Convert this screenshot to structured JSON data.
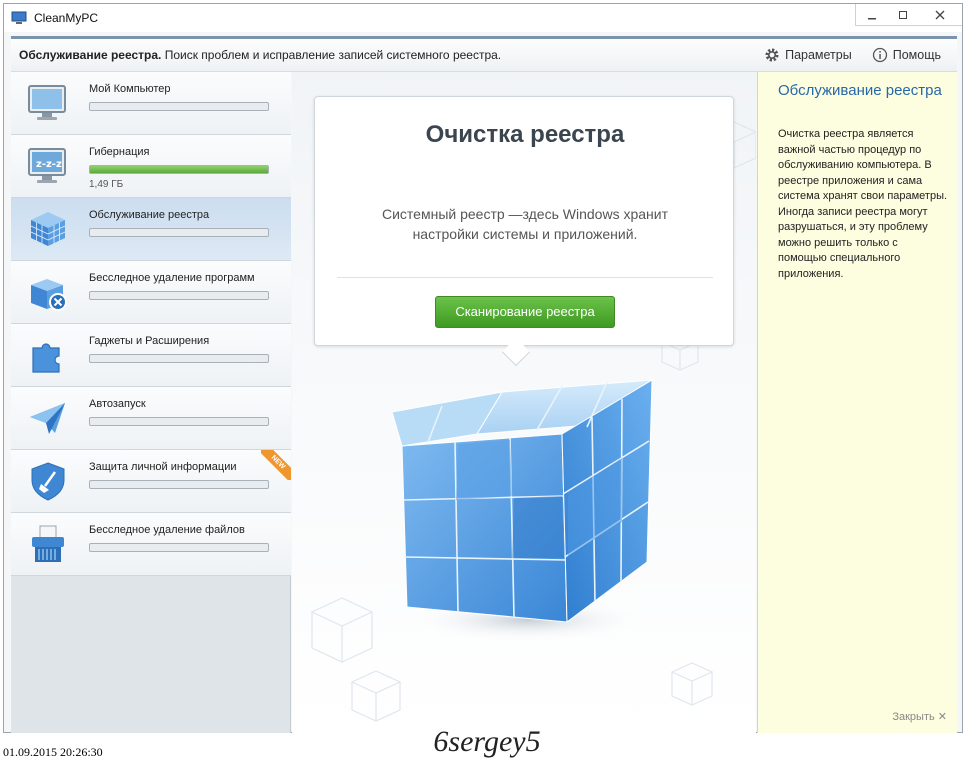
{
  "window": {
    "title": "CleanMyPC"
  },
  "header": {
    "section": "Обслуживание реестра.",
    "description": "Поиск проблем и исправление записей системного реестра.",
    "settings_label": "Параметры",
    "help_label": "Помощь"
  },
  "sidebar": {
    "items": [
      {
        "label": "Мой Компьютер",
        "progress": 0
      },
      {
        "label": "Гибернация",
        "progress": 1.0,
        "sub": "1,49 ГБ"
      },
      {
        "label": "Обслуживание реестра",
        "progress": 0,
        "active": true
      },
      {
        "label": "Бесследное удаление программ",
        "progress": 0
      },
      {
        "label": "Гаджеты и Расширения",
        "progress": 0
      },
      {
        "label": "Автозапуск",
        "progress": 0
      },
      {
        "label": "Защита личной информации",
        "progress": 0,
        "badge": "NEW"
      },
      {
        "label": "Бесследное удаление файлов",
        "progress": 0
      }
    ]
  },
  "main": {
    "card_title": "Очистка реестра",
    "card_text": "Системный реестр —здесь Windows хранит настройки системы и приложений.",
    "scan_button": "Сканирование реестра"
  },
  "info": {
    "title": "Обслуживание реестра",
    "text": "Очистка реестра является важной частью процедур по обслуживанию компьютера. В реестре приложения и сама система хранят свои параметры. Иногда записи реестра могут разрушаться, и эту проблему можно решить только с помощью специального приложения.",
    "close_label": "Закрыть"
  },
  "footer": {
    "timestamp": "01.09.2015 20:26:30",
    "watermark": "6sergey5"
  },
  "colors": {
    "accent": "#2769a8",
    "progress_green": "#5eaa3a",
    "scan_green": "#4aa82c",
    "cube_blue": "#4a90d9",
    "badge_orange": "#f0962e"
  }
}
